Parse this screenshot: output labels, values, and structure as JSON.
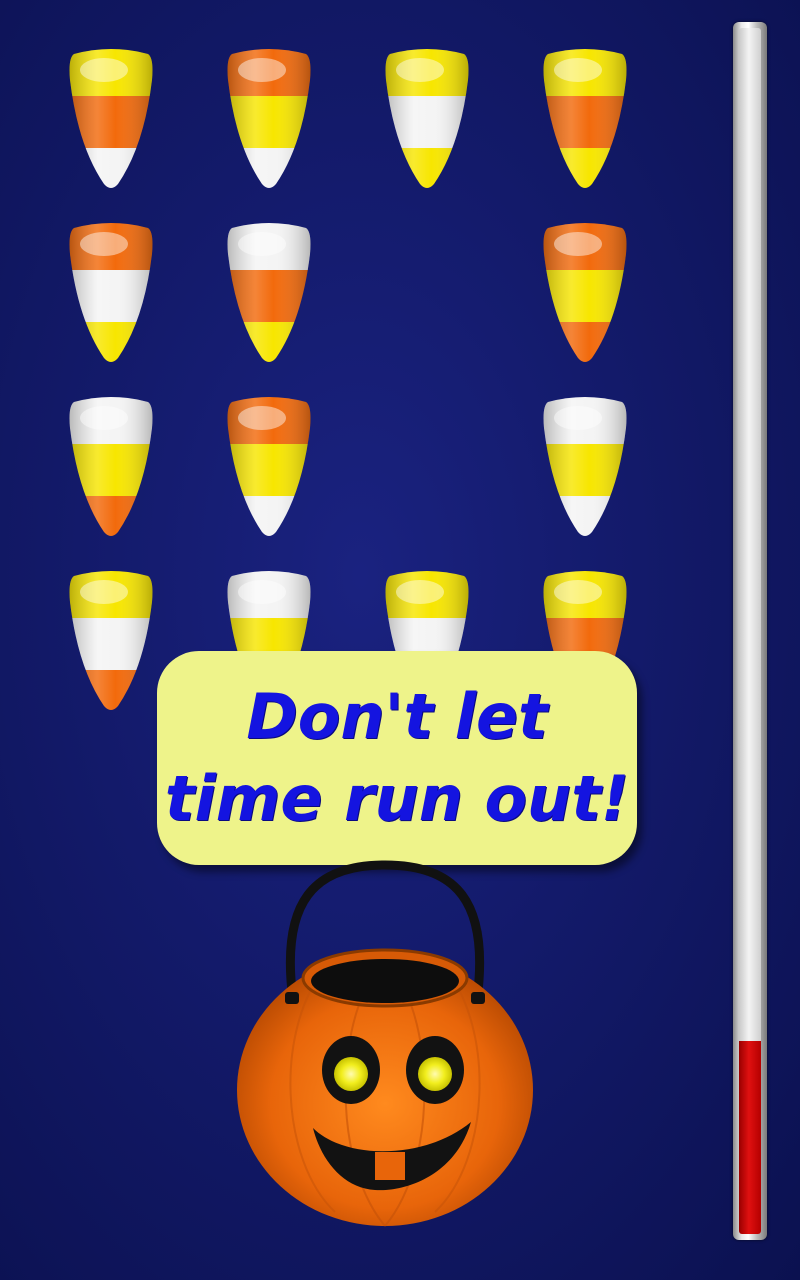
{
  "message": {
    "line1": "Don't let",
    "line2": "time run out!"
  },
  "timer": {
    "remaining_fraction": 0.16,
    "fill_color": "#d00000"
  },
  "candy_colors": {
    "yellow": "#f7e600",
    "orange": "#f26a0c",
    "white": "#f4f4f4"
  },
  "candy_grid": [
    [
      "yellow-orange-white",
      "orange-yellow-white",
      "yellow-white-yellow",
      "yellow-orange-yellow"
    ],
    [
      "orange-white-yellow",
      "white-orange-yellow",
      null,
      "orange-yellow-orange"
    ],
    [
      "white-yellow-orange",
      "orange-yellow-white",
      null,
      "white-yellow-white"
    ],
    [
      "yellow-white-orange",
      "white-yellow-white",
      "yellow-white-yellow",
      "yellow-orange-yellow"
    ]
  ],
  "bucket": {
    "icon": "jack-o-lantern-bucket-icon",
    "body_color": "#e8650a",
    "eye_color": "#f2ee1e"
  }
}
